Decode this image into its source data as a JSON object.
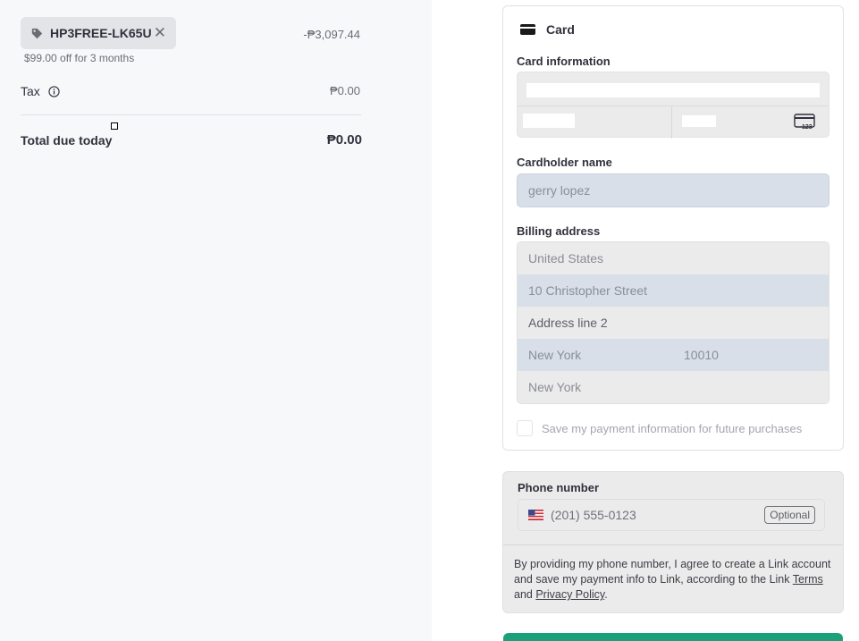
{
  "summary": {
    "promo_code": "HP3FREE-LK65U",
    "promo_amount": "-₱3,097.44",
    "promo_desc": "$99.00 off for 3 months",
    "tax_label": "Tax",
    "tax_amount": "₱0.00",
    "total_label": "Total due today",
    "total_amount": "₱0.00"
  },
  "card": {
    "title": "Card",
    "card_info_label": "Card information",
    "cardholder_label": "Cardholder name",
    "cardholder_value": "gerry lopez",
    "billing_label": "Billing address",
    "country": "United States",
    "address_line1": "10 Christopher Street",
    "address_line2_placeholder": "Address line 2",
    "city": "New York",
    "zip": "10010",
    "state": "New York",
    "save_label": "Save my payment information for future purchases"
  },
  "phone": {
    "label": "Phone number",
    "placeholder": "(201) 555-0123",
    "optional": "Optional",
    "terms_prefix": "By providing my phone number, I agree to create a Link account and save my payment info to Link, according to the Link",
    "terms_link": "Terms",
    "and": "and",
    "privacy_link": "Privacy Policy",
    "period": "."
  },
  "icons": {
    "tag": "tag-icon",
    "close": "close-icon",
    "info": "info-icon",
    "card": "card-icon",
    "cvc": "cvc-card-icon",
    "flag": "us-flag-icon"
  },
  "colors": {
    "submit": "#1aa179",
    "autofill": "#d9dfe9"
  }
}
